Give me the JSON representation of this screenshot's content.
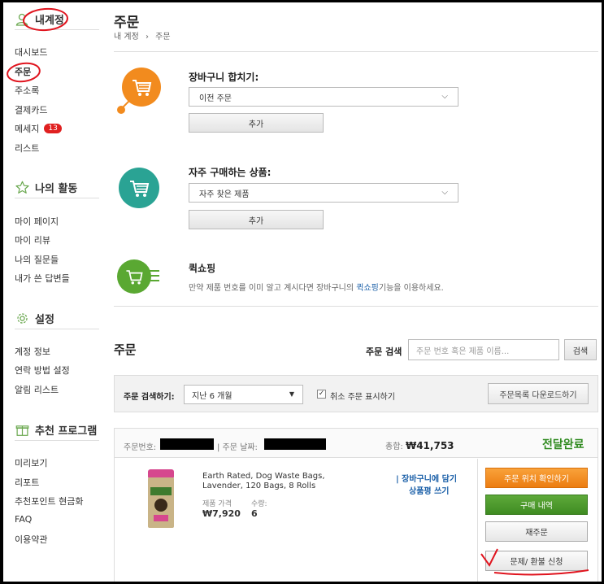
{
  "sidebar": {
    "account": {
      "title": "내계정",
      "items": [
        "대시보드",
        "주문",
        "주소록",
        "결제카드",
        "메세지",
        "리스트"
      ],
      "message_badge": "13"
    },
    "activity": {
      "title": "나의 활동",
      "items": [
        "마이 페이지",
        "마이 리뷰",
        "나의 질문들",
        "내가 쓴 답변들"
      ]
    },
    "settings": {
      "title": "설정",
      "items": [
        "계정 정보",
        "연락 방법 설정",
        "알림 리스트"
      ]
    },
    "referral": {
      "title": "추천 프로그램",
      "items": [
        "미리보기",
        "리포트",
        "추천포인트 현금화",
        "FAQ",
        "이용약관"
      ]
    }
  },
  "header": {
    "title": "주문",
    "breadcrumb_home": "내 계정",
    "breadcrumb_sep": "›",
    "breadcrumb_current": "주문"
  },
  "merge_cart": {
    "label": "장바구니 합치기:",
    "selected": "이전 주문",
    "button": "추가",
    "icon": "cart-icon"
  },
  "frequent": {
    "label": "자주 구매하는 상품:",
    "selected": "자주 찾은 제품",
    "button": "추가",
    "icon": "cart-icon"
  },
  "quick_shop": {
    "label": "퀵쇼핑",
    "desc_before": "만약 제품 번호를 이미 알고 계시다면 장바구니의 ",
    "desc_link": "퀵쇼핑",
    "desc_after": "기능을 이용하세요.",
    "icon": "fast-cart-icon"
  },
  "orders": {
    "title": "주문",
    "search_label": "주문 검색",
    "search_placeholder": "주문 번호 혹은 제품 이름...",
    "search_button": "검색",
    "filter_label": "주문 검색하기:",
    "period": "지난 6 개월",
    "show_cancelled": "취소 주문 표시하기",
    "show_cancelled_checked": true,
    "download_button": "주문목록 다운로드하기"
  },
  "order": {
    "number_label": "주문번호:",
    "date_label": "| 주문 날짜:",
    "total_label": "총합:",
    "total_value": "₩41,753",
    "status": "전달완료",
    "product_name": "Earth Rated, Dog Waste Bags, Lavender, 120 Bags, 8 Rolls",
    "price_label": "제품 가격",
    "price_value": "₩7,920",
    "qty_label": "수량:",
    "qty_value": "6",
    "add_to_cart": "| 장바구니에 담기",
    "write_review": "상품평 쓰기",
    "track_button": "주문 위치 확인하기",
    "history_button": "구매 내역",
    "reorder_button": "재주문",
    "refund_button": "문제/ 환불 신청"
  },
  "colors": {
    "orange": "#f28b1e",
    "teal": "#2aa394",
    "green": "#5aa832",
    "status_green": "#2f8a1f",
    "link_blue": "#1a5fa8",
    "annotation_red": "#e0141e"
  }
}
